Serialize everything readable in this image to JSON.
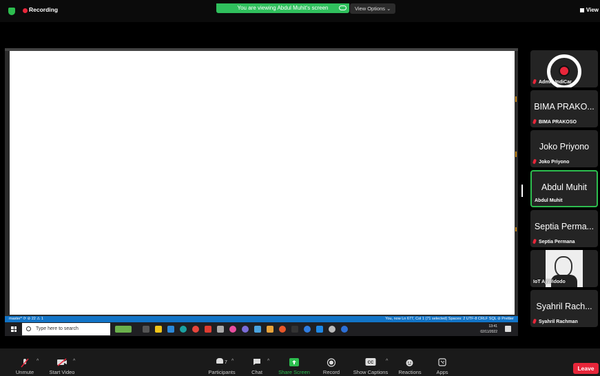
{
  "topbar": {
    "recording": "Recording",
    "share_banner": "You are viewing Abdul Muhit's screen",
    "view_options": "View Options ⌄",
    "view": "View"
  },
  "shared_screen": {
    "status_left": "master*  ⟳  ⊘ 22 ⚠ 1",
    "status_right": "You, now   Ln 677, Col 1 (71 selected)   Spaces: 2   UTF-8   CRLF   SQL   ⊘ Prettier",
    "search_placeholder": "Type here to search",
    "clock_time": "13:41",
    "clock_date": "02/11/2022"
  },
  "participants": [
    {
      "label": "Admin IndiCar",
      "big": "",
      "kind": "avatar"
    },
    {
      "label": "BIMA PRAKOSO",
      "big": "BIMA PRAKO...",
      "kind": "name"
    },
    {
      "label": "Joko Priyono",
      "big": "Joko Priyono",
      "kind": "name"
    },
    {
      "label": "Abdul Muhit",
      "big": "Abdul Muhit",
      "kind": "active"
    },
    {
      "label": "Septia Permana",
      "big": "Septia Perma...",
      "kind": "name"
    },
    {
      "label": "IoT AjiWidodo",
      "big": "",
      "kind": "photo"
    },
    {
      "label": "Syahril Rachman",
      "big": "Syahril Rach...",
      "kind": "name"
    }
  ],
  "toolbar": {
    "unmute": "Unmute",
    "start_video": "Start Video",
    "participants": "Participants",
    "participants_count": "7",
    "chat": "Chat",
    "share_screen": "Share Screen",
    "record": "Record",
    "show_captions": "Show Captions",
    "reactions": "Reactions",
    "apps": "Apps",
    "leave": "Leave"
  },
  "colors": {
    "accent_green": "#2dbe4f",
    "recording_red": "#e8263a",
    "status_blue": "#1274c7"
  }
}
